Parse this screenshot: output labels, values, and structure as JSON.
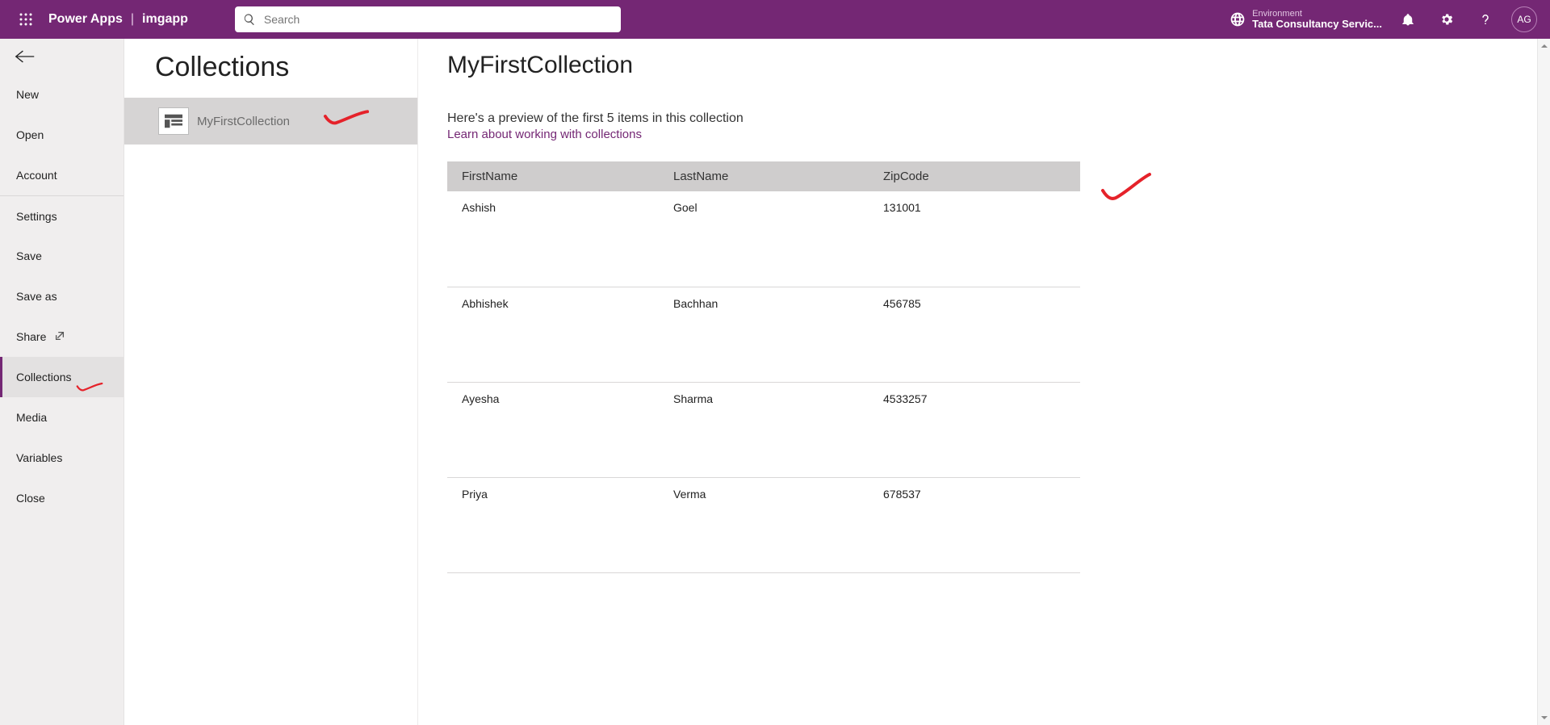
{
  "header": {
    "brand": "Power Apps",
    "separator": "|",
    "app_name": "imgapp",
    "search_placeholder": "Search",
    "env_label": "Environment",
    "env_name": "Tata Consultancy Servic...",
    "avatar_initials": "AG"
  },
  "sidebar": {
    "items": [
      {
        "label": "New"
      },
      {
        "label": "Open"
      },
      {
        "label": "Account"
      },
      {
        "label": "Settings"
      },
      {
        "label": "Save"
      },
      {
        "label": "Save as"
      },
      {
        "label": "Share",
        "ext": true
      },
      {
        "label": "Collections",
        "active": true
      },
      {
        "label": "Media"
      },
      {
        "label": "Variables"
      },
      {
        "label": "Close"
      }
    ]
  },
  "collections_panel": {
    "page_title": "Collections",
    "items": [
      {
        "name": "MyFirstCollection"
      }
    ]
  },
  "detail": {
    "title": "MyFirstCollection",
    "preview_text": "Here's a preview of the first 5 items in this collection",
    "learn_link": "Learn about working with collections",
    "columns": [
      "FirstName",
      "LastName",
      "ZipCode"
    ],
    "rows": [
      {
        "FirstName": "Ashish",
        "LastName": "Goel",
        "ZipCode": "131001"
      },
      {
        "FirstName": "Abhishek",
        "LastName": "Bachhan",
        "ZipCode": "456785"
      },
      {
        "FirstName": "Ayesha",
        "LastName": "Sharma",
        "ZipCode": "4533257"
      },
      {
        "FirstName": "Priya",
        "LastName": "Verma",
        "ZipCode": "678537"
      }
    ]
  }
}
